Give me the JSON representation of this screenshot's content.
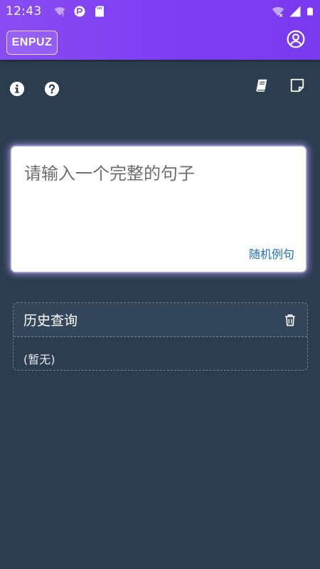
{
  "status_bar": {
    "time": "12:43",
    "left_icons": [
      "wifi-question-icon",
      "app-notification-icon",
      "sd-card-icon"
    ],
    "right_icons": [
      "wifi-icon",
      "signal-icon",
      "battery-icon"
    ]
  },
  "app_bar": {
    "brand": "ENPUZ",
    "account_icon": "account-circle-icon",
    "color": "#7e3df3"
  },
  "toolbar": {
    "left_icons": [
      "info-icon",
      "help-icon"
    ],
    "right_icons": [
      "book-icon",
      "note-icon"
    ]
  },
  "input": {
    "placeholder": "请输入一个完整的句子",
    "value": "",
    "random_example_label": "随机例句"
  },
  "history": {
    "title": "历史查询",
    "clear_icon": "trash-icon",
    "empty_text": "(暂无)"
  },
  "colors": {
    "background": "#2c3d50",
    "accent": "#7e3df3",
    "link": "#1a6fb8"
  }
}
